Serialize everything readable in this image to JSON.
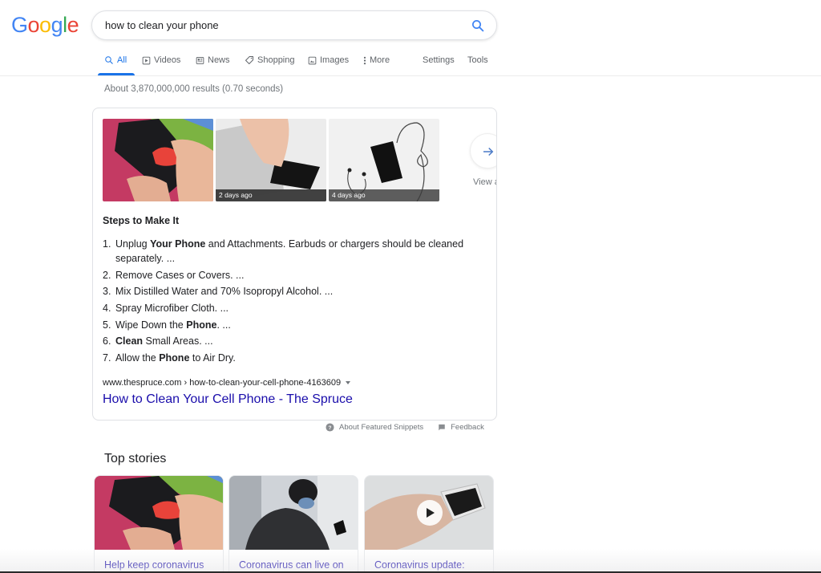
{
  "header": {
    "logo_letters": [
      {
        "ch": "G",
        "color": "#4285F4"
      },
      {
        "ch": "o",
        "color": "#EA4335"
      },
      {
        "ch": "o",
        "color": "#FBBC05"
      },
      {
        "ch": "g",
        "color": "#4285F4"
      },
      {
        "ch": "l",
        "color": "#34A853"
      },
      {
        "ch": "e",
        "color": "#EA4335"
      }
    ],
    "search_query": "how to clean your phone",
    "search_icon": "search-icon"
  },
  "tabs": [
    {
      "label": "All",
      "icon": "search-icon",
      "active": true
    },
    {
      "label": "Videos",
      "icon": "play-box-icon"
    },
    {
      "label": "News",
      "icon": "newspaper-icon"
    },
    {
      "label": "Shopping",
      "icon": "tag-icon"
    },
    {
      "label": "Images",
      "icon": "image-icon"
    },
    {
      "label": "More",
      "icon": "more-vertical-icon"
    },
    {
      "label": "Settings"
    },
    {
      "label": "Tools"
    }
  ],
  "result_stats": "About 3,870,000,000 results (0.70 seconds)",
  "featured_snippet": {
    "images": [
      {
        "caption": ""
      },
      {
        "caption": "2 days ago"
      },
      {
        "caption": "4 days ago"
      }
    ],
    "view_all_label": "View all",
    "steps_title": "Steps to Make It",
    "steps": [
      {
        "num": "1.",
        "parts": [
          {
            "t": "Unplug "
          },
          {
            "t": "Your Phone",
            "b": true
          },
          {
            "t": " and Attachments. Earbuds or chargers should be cleaned separately. ..."
          }
        ]
      },
      {
        "num": "2.",
        "parts": [
          {
            "t": "Remove Cases or Covers. ..."
          }
        ]
      },
      {
        "num": "3.",
        "parts": [
          {
            "t": "Mix Distilled Water and 70% Isopropyl Alcohol. ..."
          }
        ]
      },
      {
        "num": "4.",
        "parts": [
          {
            "t": "Spray Microfiber Cloth. ..."
          }
        ]
      },
      {
        "num": "5.",
        "parts": [
          {
            "t": "Wipe Down the "
          },
          {
            "t": "Phone",
            "b": true
          },
          {
            "t": ". ..."
          }
        ]
      },
      {
        "num": "6.",
        "parts": [
          {
            "t": "Clean",
            "b": true
          },
          {
            "t": " Small Areas. ..."
          }
        ]
      },
      {
        "num": "7.",
        "parts": [
          {
            "t": "Allow the "
          },
          {
            "t": "Phone",
            "b": true
          },
          {
            "t": " to Air Dry."
          }
        ]
      }
    ],
    "source_url": "www.thespruce.com › how-to-clean-your-cell-phone-4163609",
    "source_title": "How to Clean Your Cell Phone - The Spruce"
  },
  "snippet_footer": {
    "about_label": "About Featured Snippets",
    "feedback_label": "Feedback"
  },
  "top_stories": {
    "title": "Top stories",
    "stories": [
      {
        "title": "Help keep coronavirus",
        "has_video": false
      },
      {
        "title": "Coronavirus can live on",
        "has_video": false
      },
      {
        "title": "Coronavirus update:",
        "has_video": true
      }
    ]
  },
  "colors": {
    "link_blue": "#1a0dab",
    "accent_blue": "#1a73e8",
    "muted_gray": "#70757a"
  }
}
